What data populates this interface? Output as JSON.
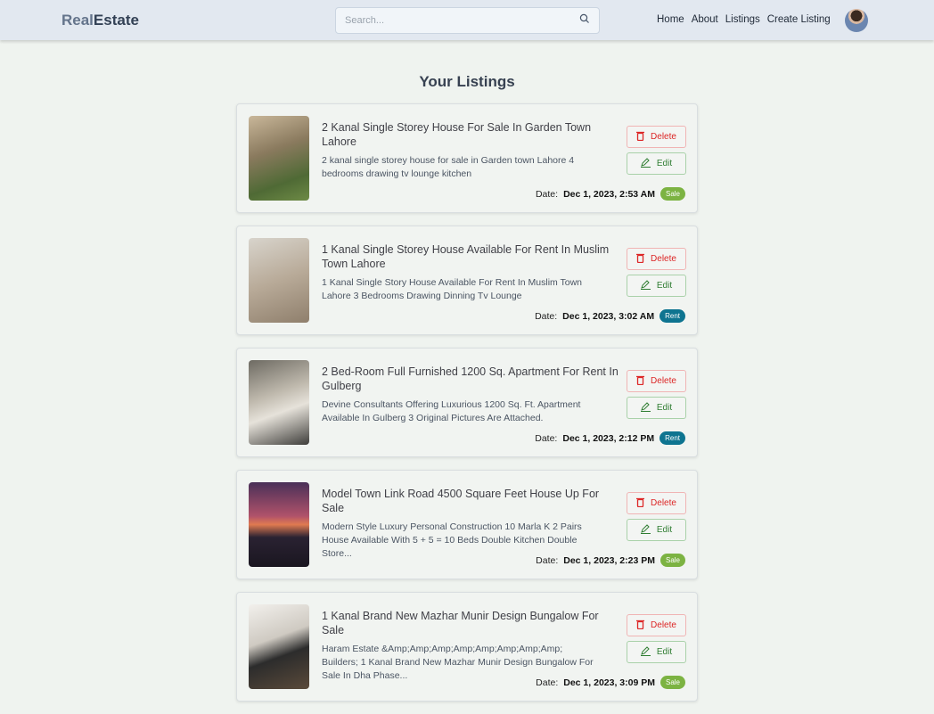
{
  "header": {
    "logo_a": "Real",
    "logo_b": "Estate",
    "search_placeholder": "Search...",
    "nav": [
      "Home",
      "About",
      "Listings",
      "Create Listing"
    ]
  },
  "page_title": "Your Listings",
  "labels": {
    "delete": "Delete",
    "edit": "Edit",
    "date": "Date:"
  },
  "colors": {
    "sale": "#7cb342",
    "rent": "#0e7490"
  },
  "listings": [
    {
      "title": "2 Kanal Single Storey House For Sale In Garden Town Lahore",
      "desc": "2 kanal single storey house for sale in Garden town Lahore 4 bedrooms drawing tv lounge kitchen",
      "date": "Dec 1, 2023, 2:53 AM",
      "type": "Sale"
    },
    {
      "title": "1 Kanal Single Storey House Available For Rent In Muslim Town Lahore",
      "desc": "1 Kanal Single Story House Available For Rent In Muslim Town Lahore 3 Bedrooms Drawing Dinning Tv Lounge",
      "date": "Dec 1, 2023, 3:02 AM",
      "type": "Rent"
    },
    {
      "title": "2 Bed-Room Full Furnished 1200 Sq. Apartment For Rent In Gulberg",
      "desc": "Devine Consultants Offering Luxurious 1200 Sq. Ft. Apartment Available In Gulberg 3 Original Pictures Are Attached.",
      "date": "Dec 1, 2023, 2:12 PM",
      "type": "Rent"
    },
    {
      "title": "Model Town Link Road 4500 Square Feet House Up For Sale",
      "desc": "Modern Style Luxury Personal Construction 10 Marla K 2 Pairs House Available With 5 + 5 = 10 Beds Double Kitchen Double Store...",
      "date": "Dec 1, 2023, 2:23 PM",
      "type": "Sale"
    },
    {
      "title": "1 Kanal Brand New Mazhar Munir Design Bungalow For Sale",
      "desc": "Haram Estate &Amp;Amp;Amp;Amp;Amp;Amp;Amp;Amp; Builders; 1 Kanal Brand New Mazhar Munir Design Bungalow For Sale In Dha Phase...",
      "date": "Dec 1, 2023, 3:09 PM",
      "type": "Sale"
    }
  ]
}
